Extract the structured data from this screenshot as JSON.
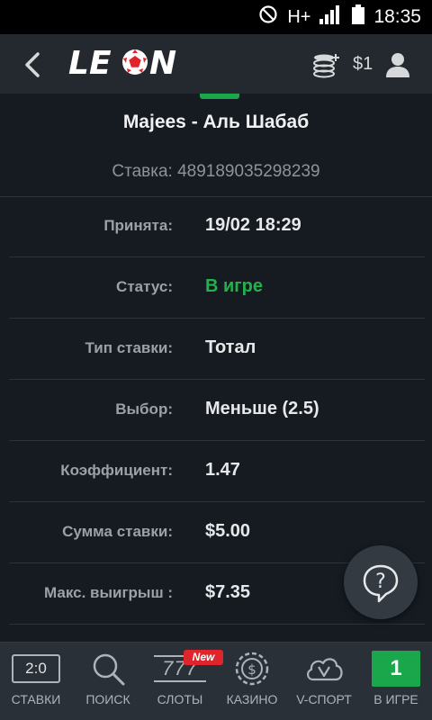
{
  "status_bar": {
    "network": "H+",
    "time": "18:35"
  },
  "header": {
    "logo": "LEON",
    "balance": "$1"
  },
  "bet": {
    "title": "Majees - Аль Шабаб",
    "id_text": "Ставка: 489189035298239",
    "rows": [
      {
        "label": "Принята:",
        "value": "19/02 18:29"
      },
      {
        "label": "Статус:",
        "value": "В игре"
      },
      {
        "label": "Тип ставки:",
        "value": "Тотал"
      },
      {
        "label": "Выбор:",
        "value": "Меньше (2.5)"
      },
      {
        "label": "Коэффициент:",
        "value": "1.47"
      },
      {
        "label": "Сумма ставки:",
        "value": "$5.00"
      },
      {
        "label": "Макс. выигрыш :",
        "value": "$7.35"
      }
    ]
  },
  "bottom_nav": {
    "items": [
      {
        "label": "СТАВКИ",
        "icon": "score-board-icon",
        "icon_text": "2:0"
      },
      {
        "label": "ПОИСК",
        "icon": "search-icon"
      },
      {
        "label": "СЛОТЫ",
        "icon": "slots-777-icon",
        "icon_text": "777"
      },
      {
        "label": "КАЗИНО",
        "icon": "casino-chip-icon"
      },
      {
        "label": "V-СПОРТ",
        "icon": "cloud-v-icon"
      },
      {
        "label": "В ИГРЕ",
        "icon": "live-count-icon",
        "icon_text": "1"
      }
    ],
    "new_badge": "New"
  },
  "colors": {
    "background": "#161b22",
    "header": "#24292f",
    "accent_green": "#1aa64b",
    "badge_red": "#e0242b"
  }
}
